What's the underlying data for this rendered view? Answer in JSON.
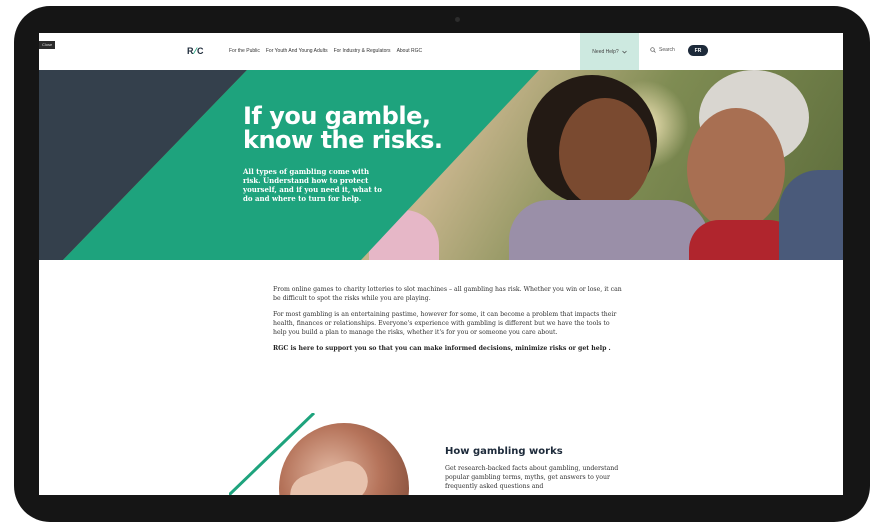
{
  "overlay": {
    "label": "Close"
  },
  "brand": {
    "logo_left": "R",
    "logo_mid": "G",
    "logo_right": "C",
    "accent": "#1ea37d",
    "dark": "#34404c"
  },
  "nav": {
    "links": [
      "For the Public",
      "For Youth And Young Adults",
      "For Industry & Regulators",
      "About RGC"
    ],
    "need_help": "Need Help?",
    "search": "Search",
    "lang": "FR"
  },
  "hero": {
    "title_line1": "If you gamble,",
    "title_line2": "know the risks.",
    "subtitle": "All types of gambling come with risk. Understand how to protect yourself, and if you need it, what to do and where to turn for help."
  },
  "intro": {
    "p1": "From online games to charity lotteries to slot machines – all gambling has risk. Whether you win or lose, it can be difficult to spot the risks while you are playing.",
    "p2": "For most gambling is an entertaining pastime, however for some, it can become a problem that impacts their health, finances or relationships. Everyone's experience with gambling is different but we have the tools to help you build a plan to manage the risks, whether it's for you or someone you care about.",
    "p3": "RGC is here to support you so that you can make informed decisions, minimize risks or get help ."
  },
  "section": {
    "title": "How gambling works",
    "text": "Get research-backed facts about gambling, understand popular gambling terms, myths, get answers to your frequently asked questions and"
  }
}
